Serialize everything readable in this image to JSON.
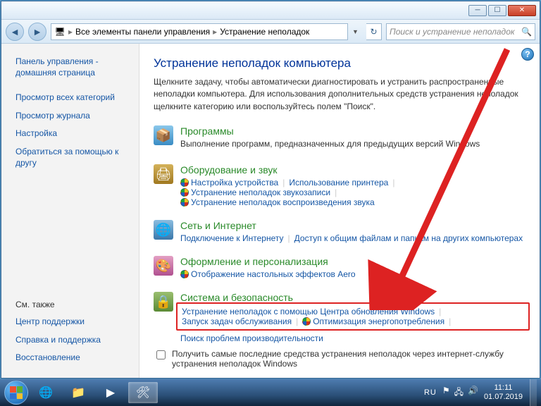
{
  "breadcrumbs": {
    "item1": "Все элементы панели управления",
    "item2": "Устранение неполадок"
  },
  "search": {
    "placeholder": "Поиск и устранение неполадок"
  },
  "sidebar": {
    "home": "Панель управления - домашняя страница",
    "links": {
      "0": "Просмотр всех категорий",
      "1": "Просмотр журнала",
      "2": "Настройка",
      "3": "Обратиться за помощью к другу"
    },
    "see_also_hdr": "См. также",
    "see_also": {
      "0": "Центр поддержки",
      "1": "Справка и поддержка",
      "2": "Восстановление"
    }
  },
  "main": {
    "title": "Устранение неполадок компьютера",
    "intro": "Щелкните задачу, чтобы автоматически диагностировать и устранить распространенные неполадки компьютера. Для использования дополнительных средств устранения неполадок щелкните категорию или воспользуйтесь полем \"Поиск\".",
    "cat": {
      "programs": {
        "title": "Программы",
        "sub": "Выполнение программ, предназначенных для предыдущих версий Windows"
      },
      "hardware": {
        "title": "Оборудование и звук",
        "links": {
          "0": "Настройка устройства",
          "1": "Использование принтера",
          "2": "Устранение неполадок звукозаписи",
          "3": "Устранение неполадок воспроизведения звука"
        }
      },
      "network": {
        "title": "Сеть и Интернет",
        "links": {
          "0": "Подключение к Интернету",
          "1": "Доступ к общим файлам и папкам на других компьютерах"
        }
      },
      "personalization": {
        "title": "Оформление и персонализация",
        "links": {
          "0": "Отображение настольных эффектов Aero"
        }
      },
      "security": {
        "title": "Система и безопасность",
        "links": {
          "0": "Устранение неполадок с помощью Центра обновления Windows",
          "1": "Запуск задач обслуживания",
          "2": "Оптимизация энергопотребления",
          "3": "Поиск проблем производительности"
        }
      }
    },
    "checkbox_label": "Получить самые последние средства устранения неполадок через интернет-службу устранения неполадок Windows"
  },
  "taskbar": {
    "lang": "RU",
    "time": "11:11",
    "date": "01.07.2019"
  }
}
